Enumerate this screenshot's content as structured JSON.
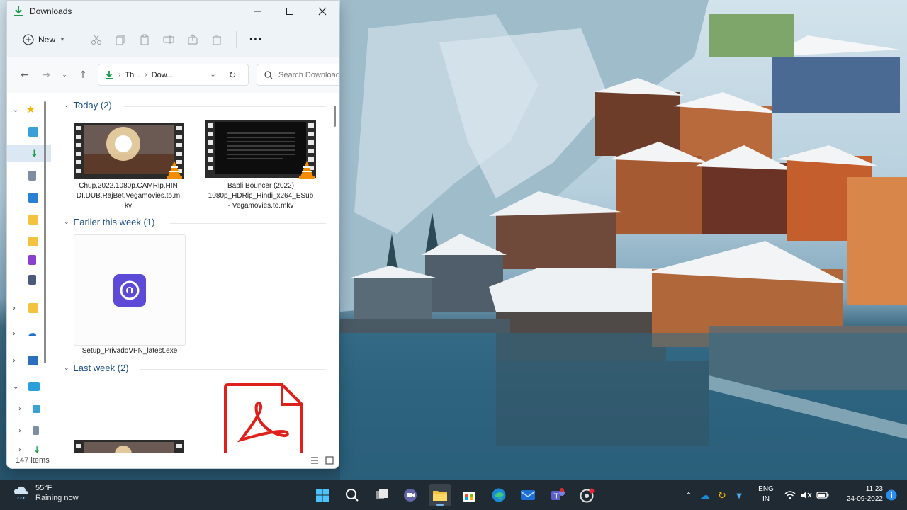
{
  "window": {
    "title": "Downloads",
    "new_label": "New",
    "breadcrumb": [
      "Th...",
      "Dow..."
    ],
    "search_placeholder": "Search Downloads",
    "status_count": "147 items"
  },
  "groups": [
    {
      "label": "Today (2)"
    },
    {
      "label": "Earlier this week (1)"
    },
    {
      "label": "Last week (2)"
    }
  ],
  "files": {
    "chup": "Chup.2022.1080p.CAMRip.HINDI.DUB.RajBet.Vegamovies.to.mkv",
    "chup_lines": [
      "Chup.2022.1080p.CAMRip.HIN",
      "DI.DUB.RajBet.Vegamovies.to.m",
      "kv"
    ],
    "babli_lines": [
      "Babli Bouncer (2022)",
      "1080p_HDRip_Hindi_x264_ESub",
      "- Vegamovies.to.mkv"
    ],
    "setup": "Setup_PrivadoVPN_latest.exe"
  },
  "taskbar": {
    "temp": "55°F",
    "weather": "Raining now",
    "lang1": "ENG",
    "lang2": "IN",
    "time": "11:23",
    "date": "24-09-2022"
  },
  "colors": {
    "accent": "#1c4f86",
    "taskbar": "#1f2a33",
    "pdf_red": "#e0201b",
    "vpn_purple": "#5b4bd6"
  }
}
